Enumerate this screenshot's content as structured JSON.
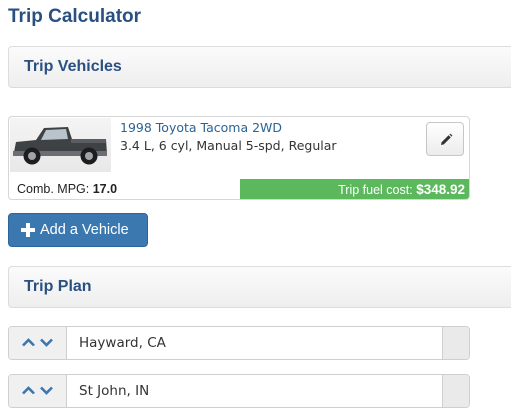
{
  "page": {
    "title": "Trip Calculator"
  },
  "vehicles_section": {
    "label": "Trip Vehicles"
  },
  "vehicle": {
    "name": "1998 Toyota Tacoma 2WD",
    "specs": "3.4 L, 6 cyl, Manual 5-spd, Regular",
    "mpg_label": "Comb. MPG:",
    "mpg_value": "17.0",
    "fuel_cost_label": "Trip fuel cost:",
    "fuel_cost_value": "$348.92",
    "thumbnail": "pickup-truck-photo",
    "edit_icon": "pencil-icon"
  },
  "add_vehicle": {
    "label": "Add a Vehicle",
    "icon": "plus-icon"
  },
  "plan_section": {
    "label": "Trip Plan"
  },
  "stops": [
    {
      "value": "Hayward, CA"
    },
    {
      "value": "St John, IN"
    }
  ],
  "colors": {
    "heading": "#2a5082",
    "link": "#2a6496",
    "primary_button": "#3b78b0",
    "fuel_cost_bar": "#5cb85c",
    "arrow": "#3b78b0"
  }
}
